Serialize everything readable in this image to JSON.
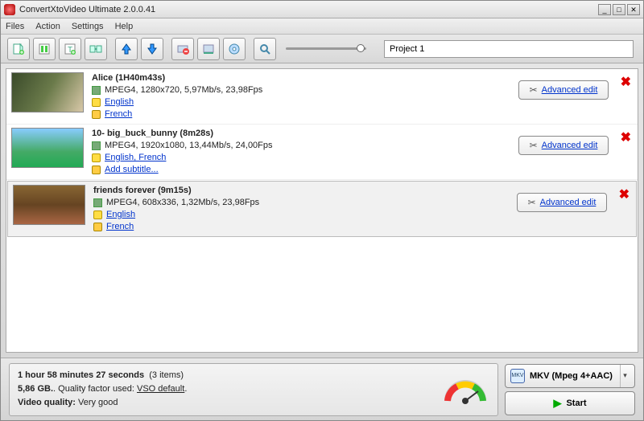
{
  "window": {
    "title": "ConvertXtoVideo Ultimate 2.0.0.41"
  },
  "menu": {
    "files": "Files",
    "action": "Action",
    "settings": "Settings",
    "help": "Help"
  },
  "toolbar": {
    "project_name": "Project 1"
  },
  "list": {
    "items": [
      {
        "title": "Alice (1H40m43s)",
        "meta": "MPEG4, 1280x720, 5,97Mb/s, 23,98Fps",
        "audio": "English",
        "sub": "French",
        "advanced": "Advanced edit"
      },
      {
        "title": "10- big_buck_bunny (8m28s)",
        "meta": "MPEG4, 1920x1080, 13,44Mb/s, 24,00Fps",
        "audio": "English, French",
        "sub": "Add subtitle...",
        "advanced": "Advanced edit"
      },
      {
        "title": "friends forever (9m15s)",
        "meta": "MPEG4, 608x336, 1,32Mb/s, 23,98Fps",
        "audio": "English",
        "sub": "French",
        "advanced": "Advanced edit"
      }
    ]
  },
  "footer": {
    "duration": "1 hour 58 minutes 27 seconds",
    "items_count": "(3 items)",
    "size": "5,86 GB.",
    "quality_factor_label": ". Quality factor used:",
    "quality_factor_value": "VSO default",
    "video_quality_label": "Video quality:",
    "video_quality_value": "Very good",
    "format": "MKV (Mpeg 4+AAC)",
    "format_icon": "MKV",
    "start": "Start"
  }
}
